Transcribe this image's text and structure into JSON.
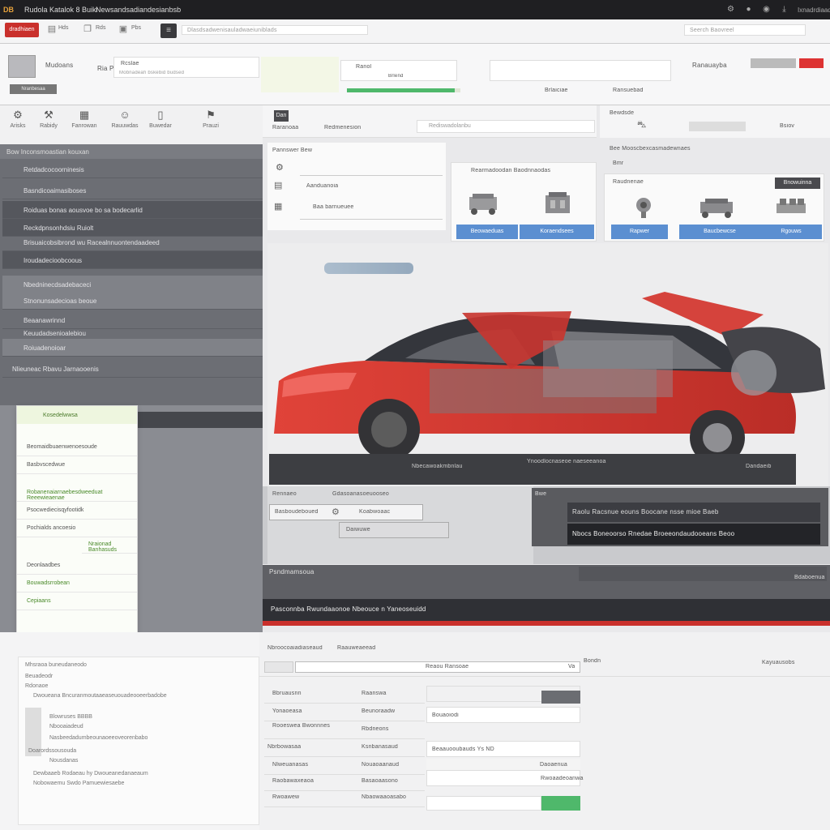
{
  "titlebar": {
    "brand": "DB",
    "title": "Rudola Katalok 8 Buiki",
    "doc": "Newsandsadiandesianbsb",
    "user": "Ixnadrdiaad"
  },
  "toolbar": {
    "red_button": "dradhiaen",
    "tools": [
      "Hds",
      "Rds",
      "Pbs",
      "Pkd"
    ],
    "url": "Dlasdsadwenisauladwaeiuniblads",
    "search": "Seerch Baovreel"
  },
  "header": {
    "brand_line1": "Mudoans",
    "brand_line2": "Ria Pilat",
    "gray_btn": "Nranbesaa",
    "field_label": "Rcslae",
    "field_sub": "Mobnadeah bskebid budsed",
    "model_label": "Ranol",
    "model_value": "Brlend",
    "status_text": "Brlaiciae",
    "right_label": "Ranauayba",
    "right_sub": "Ransuebad",
    "progress": 0.95
  },
  "iconrow": [
    {
      "icon": "gear-icon",
      "label": "Arisks"
    },
    {
      "icon": "wrench-icon",
      "label": "Rabidy"
    },
    {
      "icon": "engine-icon",
      "label": "Fanrowan"
    },
    {
      "icon": "person-icon",
      "label": "Rauuwdas"
    },
    {
      "icon": "door-icon",
      "label": "Buwedar"
    },
    {
      "icon": "seat-icon",
      "label": "Prauzi"
    }
  ],
  "sidebar": {
    "header": "Bow Inconsmoastian kouxan",
    "items": [
      "Retdadcocoorninesis",
      "Basndicoaimasiboses",
      "Roiduas bonas aousvoe bo sa bodecarlid",
      "Reckdpnsonhdsiu Ruiolt",
      "Brisuaicobsibrond wu Racealnnuontendaadeed",
      "Iroudadecioobcoous",
      "Nbedninecdsadebaceci",
      "Stnonunsadecioas beoue",
      "Beaanawrinnd",
      "Keuudadsenioalebiou",
      "Roiuadenoioar",
      "Nlieuneac  Rbavu Jarnaooenis"
    ]
  },
  "dropdown": {
    "title": "Kosedelwwsa",
    "items": [
      "Beomaidbuaenwenoesoude",
      "Basbvscedwue",
      "Robanenaiarnaebesdweeduat Reeewieaenae",
      "Psocwediecisqyfootidk",
      "Pochialds  ancoesio",
      "Nraionad  Banhasuds",
      "Deonlaadbes",
      "Bouwadsrrobean",
      "Cepiaans"
    ]
  },
  "botleft": {
    "lines": [
      "Mhsraoa buneudaneodo",
      "Beuadeodr",
      "Rdonaoe",
      "Dwoueana  Bncuranmoutaaeaseuouadeooeerbadobe",
      "Blowruses  BBBB",
      "Nbooaiadeud",
      "Nasbeedadumbeounaoeeoveorenbabo",
      "Doarordssousouda",
      "Nousdanas",
      "Dewbaaeb Rodaeau hy Dwoueanedanaeaum",
      "Nobowaemu Swdo Pamuewiesaebe"
    ]
  },
  "midtop": {
    "chip": "Dan",
    "tab1": "Raranoaa",
    "tab2": "Redmenesion",
    "dropdown": "Rediswadolanbu",
    "right_label": "Bewdsde",
    "right_chip": "Bsiov"
  },
  "parts_left": {
    "rows": [
      "Pannswer Bew",
      "Aanduanoia",
      "Baa barnueuee"
    ]
  },
  "parts_card1": {
    "title": "Rearmadoodan Baodnnaodas",
    "btn1": "Beowaeduas",
    "btn2": "Koraendsees"
  },
  "parts_card2": {
    "header": "Bee Mooscbexcasmadewnaes",
    "subheader": "Bmr",
    "label": "Raudnenae",
    "chip": "Bnowuinna",
    "btn1": "Rapwer",
    "btn2": "Baucbewcse",
    "btn3": "Rgouws"
  },
  "hero": {
    "caption": "",
    "bar_left": "Nbecawoakmbnlau",
    "bar_right": "Ynoodlocnaseoe naeseeanoa",
    "bar_far": "Dandaeib"
  },
  "midrow": {
    "label1": "Rennaeo",
    "label2": "Gdasoanasoeuooseo",
    "input1": "Basboudeboued",
    "input2": "Koabwoaac",
    "input2_label": "Daiwuwe",
    "dark_line1": "Raolu Racsnue eouns Boocane nsse mioe Baeb",
    "dark_line2": "Nbocs Boneoorso Rnedae Broeeondaudooeans Beoo",
    "right_tag": "Bwe"
  },
  "bands": {
    "band1_title": "Psndmamsoua",
    "band1_right": "Bdaboenua",
    "band2_title": "Pasconnba Rwundaaonoe Nbeouce  n  Yaneoseuidd"
  },
  "form": {
    "tab1": "Nbroocoaiadiaseaud",
    "tab2": "Raauweaeead",
    "search_value": "Reaou Ransoae",
    "search_suffix": "Va",
    "right_small": "Bondn",
    "right_label": "Kayuausobs",
    "rows": [
      {
        "a": "Bbruausnn",
        "b": "Raanswa",
        "c": "Bouaoiodi"
      },
      {
        "a": "Yonaoeasa",
        "b": "Beunoraadw",
        "c": ""
      },
      {
        "a": "Rooeswea  Bwonnnes",
        "b": "Rbdneons",
        "c": "Daoaenua"
      },
      {
        "a": "Nbrbowasaa",
        "b": "Ksnbanasaud",
        "c": ""
      },
      {
        "a": "Nlweuanasas",
        "b": "Nouaoaanaud",
        "c": "Beaauooubauds  Ys  ND"
      },
      {
        "a": "Raobawaxeaoa",
        "b": "Basaoaasono",
        "c": "Rwoaadeoanwa"
      },
      {
        "a": "Rwoawew",
        "b": "Nbaowaaoasabo",
        "c": ""
      }
    ]
  },
  "colors": {
    "accent_red": "#c9302c",
    "accent_green": "#4fb86b",
    "accent_blue": "#5b8fd1",
    "car_red": "#d6322a"
  }
}
